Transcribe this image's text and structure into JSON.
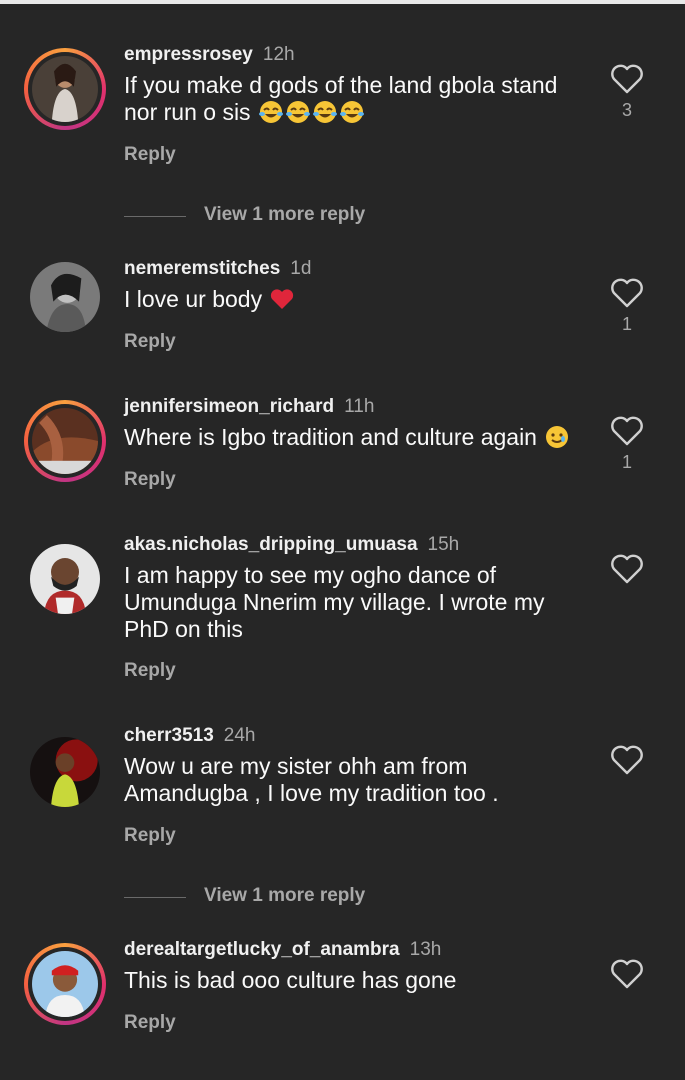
{
  "comments": [
    {
      "username": "empressrosey",
      "time": "12h",
      "text": "If you make d gods of the land gbola stand nor run o sis",
      "emoji_count": 4,
      "likes": "3",
      "reply": "Reply",
      "view_more": "View 1 more reply"
    },
    {
      "username": "nemeremstitches",
      "time": "1d",
      "text": "I love ur body",
      "likes": "1",
      "reply": "Reply"
    },
    {
      "username": "jennifersimeon_richard",
      "time": "11h",
      "text": "Where is Igbo tradition and culture again",
      "likes": "1",
      "reply": "Reply"
    },
    {
      "username": "akas.nicholas_dripping_umuasa",
      "time": "15h",
      "text": "I am happy to see my ogho dance of Umunduga Nnerim my village. I wrote my PhD on this",
      "reply": "Reply"
    },
    {
      "username": "cherr3513",
      "time": "24h",
      "text": "Wow u are my sister ohh am from Amandugba , I love my tradition too .",
      "reply": "Reply",
      "view_more": "View 1 more reply"
    },
    {
      "username": "derealtargetlucky_of_anambra",
      "time": "13h",
      "text": "This is bad ooo culture has gone",
      "reply": "Reply"
    }
  ],
  "icons": {
    "like": "heart-outline-icon",
    "laugh": "face-with-tears-of-joy-emoji",
    "heart": "red-heart-emoji",
    "smile-tear": "smiling-face-with-tear-emoji"
  },
  "colors": {
    "background": "#262626",
    "secondary_text": "#a8a8a8",
    "story_ring": "#e1306c"
  }
}
